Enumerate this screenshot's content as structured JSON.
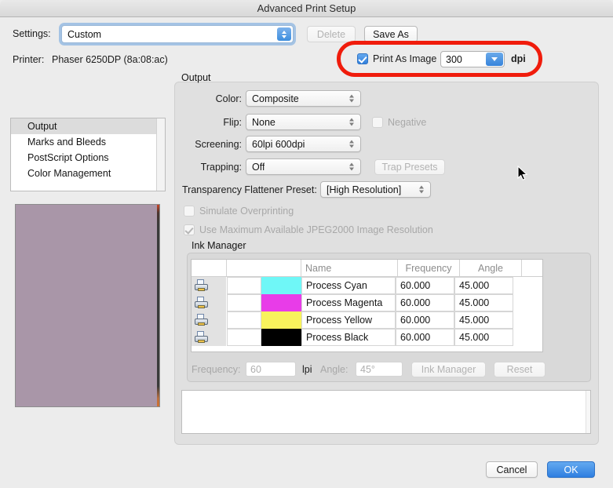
{
  "window": {
    "title": "Advanced Print Setup"
  },
  "settings_row": {
    "label": "Settings:",
    "value": "Custom",
    "delete_label": "Delete",
    "save_as_label": "Save As"
  },
  "printer_row": {
    "label": "Printer:",
    "value": "Phaser 6250DP (8a:08:ac)"
  },
  "print_as_image": {
    "checkbox_label": "Print As Image",
    "checked": true,
    "dpi_value": "300",
    "dpi_unit": "dpi"
  },
  "nav": {
    "items": [
      {
        "label": "Output",
        "selected": true
      },
      {
        "label": "Marks and Bleeds",
        "selected": false
      },
      {
        "label": "PostScript Options",
        "selected": false
      },
      {
        "label": "Color Management",
        "selected": false
      }
    ]
  },
  "output": {
    "group_label": "Output",
    "color": {
      "label": "Color:",
      "value": "Composite"
    },
    "flip": {
      "label": "Flip:",
      "value": "None"
    },
    "negative": {
      "label": "Negative",
      "checked": false
    },
    "screening": {
      "label": "Screening:",
      "value": "60lpi 600dpi"
    },
    "trapping": {
      "label": "Trapping:",
      "value": "Off"
    },
    "trap_presets_label": "Trap Presets",
    "flattener": {
      "label": "Transparency Flattener Preset:",
      "value": "[High Resolution]"
    },
    "simulate_overprinting": {
      "label": "Simulate Overprinting",
      "checked": false
    },
    "max_jpeg2000": {
      "label": "Use Maximum Available JPEG2000 Image Resolution",
      "checked": true
    }
  },
  "ink_manager": {
    "group_label": "Ink Manager",
    "columns": [
      "",
      "",
      "Name",
      "Frequency",
      "Angle",
      ""
    ],
    "rows": [
      {
        "icon": "printer-icon",
        "swatch": "#6ff7f7",
        "name": "Process Cyan",
        "frequency": "60.000",
        "angle": "45.000"
      },
      {
        "icon": "printer-icon",
        "swatch": "#e83ce8",
        "name": "Process Magenta",
        "frequency": "60.000",
        "angle": "45.000"
      },
      {
        "icon": "printer-icon",
        "swatch": "#f8f25c",
        "name": "Process Yellow",
        "frequency": "60.000",
        "angle": "45.000"
      },
      {
        "icon": "printer-icon",
        "swatch": "#000000",
        "name": "Process Black",
        "frequency": "60.000",
        "angle": "45.000"
      }
    ],
    "controls": {
      "frequency_label": "Frequency:",
      "frequency_value": "60",
      "lpi_label": "lpi",
      "angle_label": "Angle:",
      "angle_value": "45°",
      "ink_manager_button": "Ink Manager",
      "reset_button": "Reset"
    }
  },
  "description_box": {
    "text": ""
  },
  "footer": {
    "cancel_label": "Cancel",
    "ok_label": "OK"
  },
  "annotation": {
    "color": "#f01c0c",
    "shape": "ellipse-highlight"
  }
}
